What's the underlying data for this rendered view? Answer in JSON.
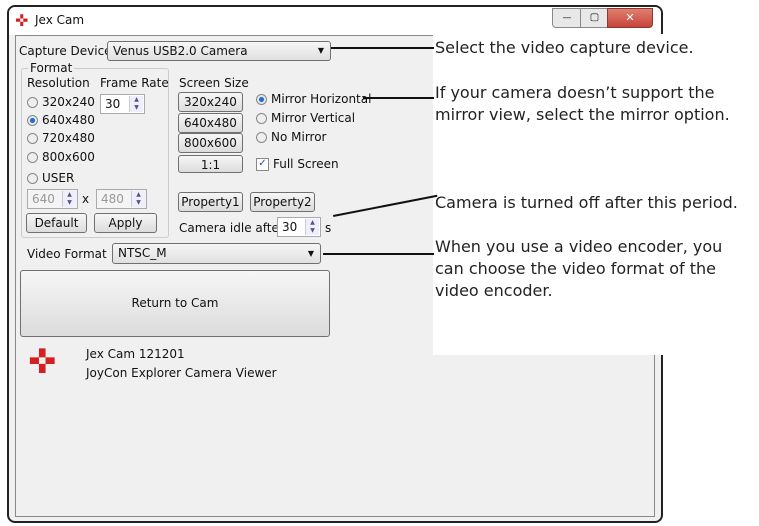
{
  "window": {
    "title": "Jex Cam",
    "controls": {
      "minimize": "—",
      "maximize": "▢",
      "close": "✕"
    }
  },
  "capture_device": {
    "label": "Capture Device",
    "value": "Venus USB2.0 Camera"
  },
  "format": {
    "group_label": "Format",
    "resolution_label": "Resolution",
    "frame_rate_label": "Frame Rate",
    "frame_rate": "30",
    "resolutions": [
      {
        "label": "320x240",
        "selected": false
      },
      {
        "label": "640x480",
        "selected": true
      },
      {
        "label": "720x480",
        "selected": false
      },
      {
        "label": "800x600",
        "selected": false
      },
      {
        "label": "USER",
        "selected": false
      }
    ],
    "user_width": "640",
    "user_x": "x",
    "user_height": "480",
    "default_label": "Default",
    "apply_label": "Apply"
  },
  "screen_size": {
    "label": "Screen Size",
    "buttons": [
      "320x240",
      "640x480",
      "800x600",
      "1:1"
    ]
  },
  "mirror": {
    "options": [
      {
        "label": "Mirror Horizontal",
        "selected": true
      },
      {
        "label": "Mirror Vertical",
        "selected": false
      },
      {
        "label": "No Mirror",
        "selected": false
      }
    ]
  },
  "full_screen": {
    "label": "Full Screen",
    "checked": true
  },
  "property1": "Property1",
  "property2": "Property2",
  "idle": {
    "label": "Camera idle after",
    "value": "30",
    "unit": "s"
  },
  "video_format": {
    "label": "Video Format",
    "value": "NTSC_M"
  },
  "return_button": "Return to Cam",
  "about": {
    "version": "Jex Cam 121201",
    "description": "JoyCon Explorer Camera Viewer"
  },
  "annotations": [
    "Select the video capture device.",
    "If your camera doesn’t support the mirror view, select the mirror option.",
    "Camera is turned off after this period.",
    "When you use a video encoder, you can choose the video format of the video encoder."
  ],
  "colors": {
    "logo": "#d42020",
    "close": "#c8433a",
    "radio_selected": "#1e6fd0"
  }
}
